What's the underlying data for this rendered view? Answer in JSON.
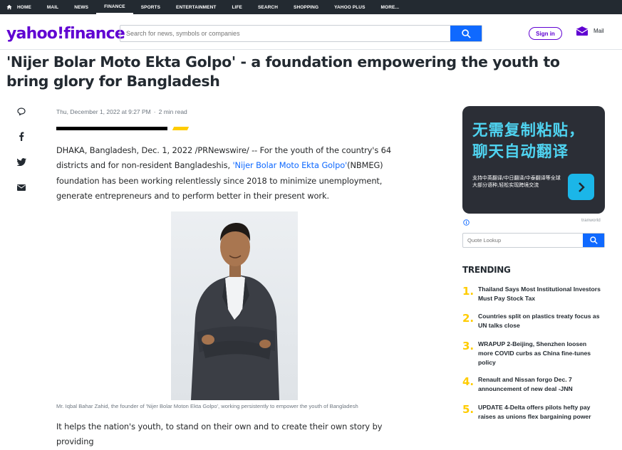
{
  "topnav": {
    "items": [
      "HOME",
      "MAIL",
      "NEWS",
      "FINANCE",
      "SPORTS",
      "ENTERTAINMENT",
      "LIFE",
      "SEARCH",
      "SHOPPING",
      "YAHOO PLUS",
      "MORE..."
    ],
    "active": "FINANCE"
  },
  "header": {
    "logo_text": "yahoo!finance",
    "search_placeholder": "Search for news, symbols or companies",
    "signin_label": "Sign in",
    "mail_label": "Mail"
  },
  "article": {
    "headline": "'Nijer Bolar Moto Ekta Golpo' - a foundation empowering the youth to bring glory for Bangladesh",
    "date": "Thu, December 1, 2022 at 9:27 PM",
    "read_time": "2 min read",
    "para1_before": "DHAKA, Bangladesh, Dec. 1, 2022 /PRNewswire/ -- For the youth of the country's 64 districts and for non-resident Bangladeshis, ",
    "para1_link": "'Nijer Bolar Moto Ekta Golpo'",
    "para1_after": "(NBMEG) foundation has been working relentlessly since 2018 to minimize unemployment, generate entrepreneurs and to perform better in their present work.",
    "caption": "Mr. Iqbal Bahar Zahid, the founder of 'Nijer Bolar Moton Ekta Golpo', working persistently to empower the youth of Bangladesh",
    "para2": "It helps the nation's youth, to stand on their own and to create their own story by providing"
  },
  "share_icons": [
    "comment-icon",
    "facebook-icon",
    "twitter-icon",
    "email-icon"
  ],
  "ad": {
    "headline_line1": "无需复制粘贴，",
    "headline_line2": "聊天自动翻译",
    "body": "支持中英翻译/中日翻译/中泰翻译等全球大部分语种,轻松实现跨境交流",
    "source": "tranworld"
  },
  "quote_lookup": {
    "placeholder": "Quote Lookup"
  },
  "trending": {
    "title": "TRENDING",
    "items": [
      {
        "num": "1.",
        "text": "Thailand Says Most Institutional Investors Must Pay Stock Tax"
      },
      {
        "num": "2.",
        "text": "Countries split on plastics treaty focus as UN talks close"
      },
      {
        "num": "3.",
        "text": "WRAPUP 2-Beijing, Shenzhen loosen more COVID curbs as China fine-tunes policy"
      },
      {
        "num": "4.",
        "text": "Renault and Nissan forgo Dec. 7 announcement of new deal -JNN"
      },
      {
        "num": "5.",
        "text": "UPDATE 4-Delta offers pilots hefty pay raises as unions flex bargaining power"
      }
    ]
  },
  "colors": {
    "brand_purple": "#6001d2",
    "accent_blue": "#0f69ff",
    "nav_dark": "#232a31",
    "trending_yellow": "#ffcc00",
    "ad_cyan": "#4fd3f0"
  }
}
